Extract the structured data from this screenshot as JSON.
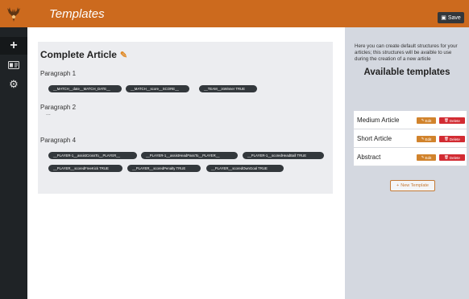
{
  "app": {
    "logo_icon": "deer-antlers-logo",
    "title": "Templates",
    "accent": "#cc6a1e"
  },
  "toolbar": {
    "save_label": "Save",
    "save_icon": "floppy-disk-icon"
  },
  "sidebar": {
    "items": [
      {
        "name": "add",
        "icon": "+"
      },
      {
        "name": "id-card",
        "icon": "▭"
      },
      {
        "name": "settings",
        "icon": "⚙"
      }
    ]
  },
  "article": {
    "title": "Complete Article",
    "paragraphs": [
      {
        "title": "Paragraph 1",
        "chips": [
          "__MATCH__date__MATCH_DATE__",
          "__MATCH__score__SCORE__",
          "__TEAM__isWinner TRUE"
        ]
      },
      {
        "title": "Paragraph 2",
        "body": "..."
      },
      {
        "title": "Paragraph 4",
        "chips": [
          "__PLAYER-1__assistCrossTo__PLAYER__",
          "__PLAYER-1__assistHeadPassTo__PLAYER__",
          "__PLAYER-1__scoredHeadBall TRUE",
          "__PLAYER__scoredFreeKick TRUE",
          "__PLAYER__scoredPenalty TRUE",
          "__PLAYER__scoredOwnGoal TRUE"
        ]
      }
    ]
  },
  "panel": {
    "description": "Here you can create default structures for your articles; this structures will be avaible to use during the creation of a new article",
    "heading": "Available templates",
    "templates": [
      {
        "name": "Medium Article"
      },
      {
        "name": "Short Article"
      },
      {
        "name": "Abstract"
      }
    ],
    "edit_label": "Edit",
    "delete_label": "Delete",
    "new_label": "New Template"
  }
}
